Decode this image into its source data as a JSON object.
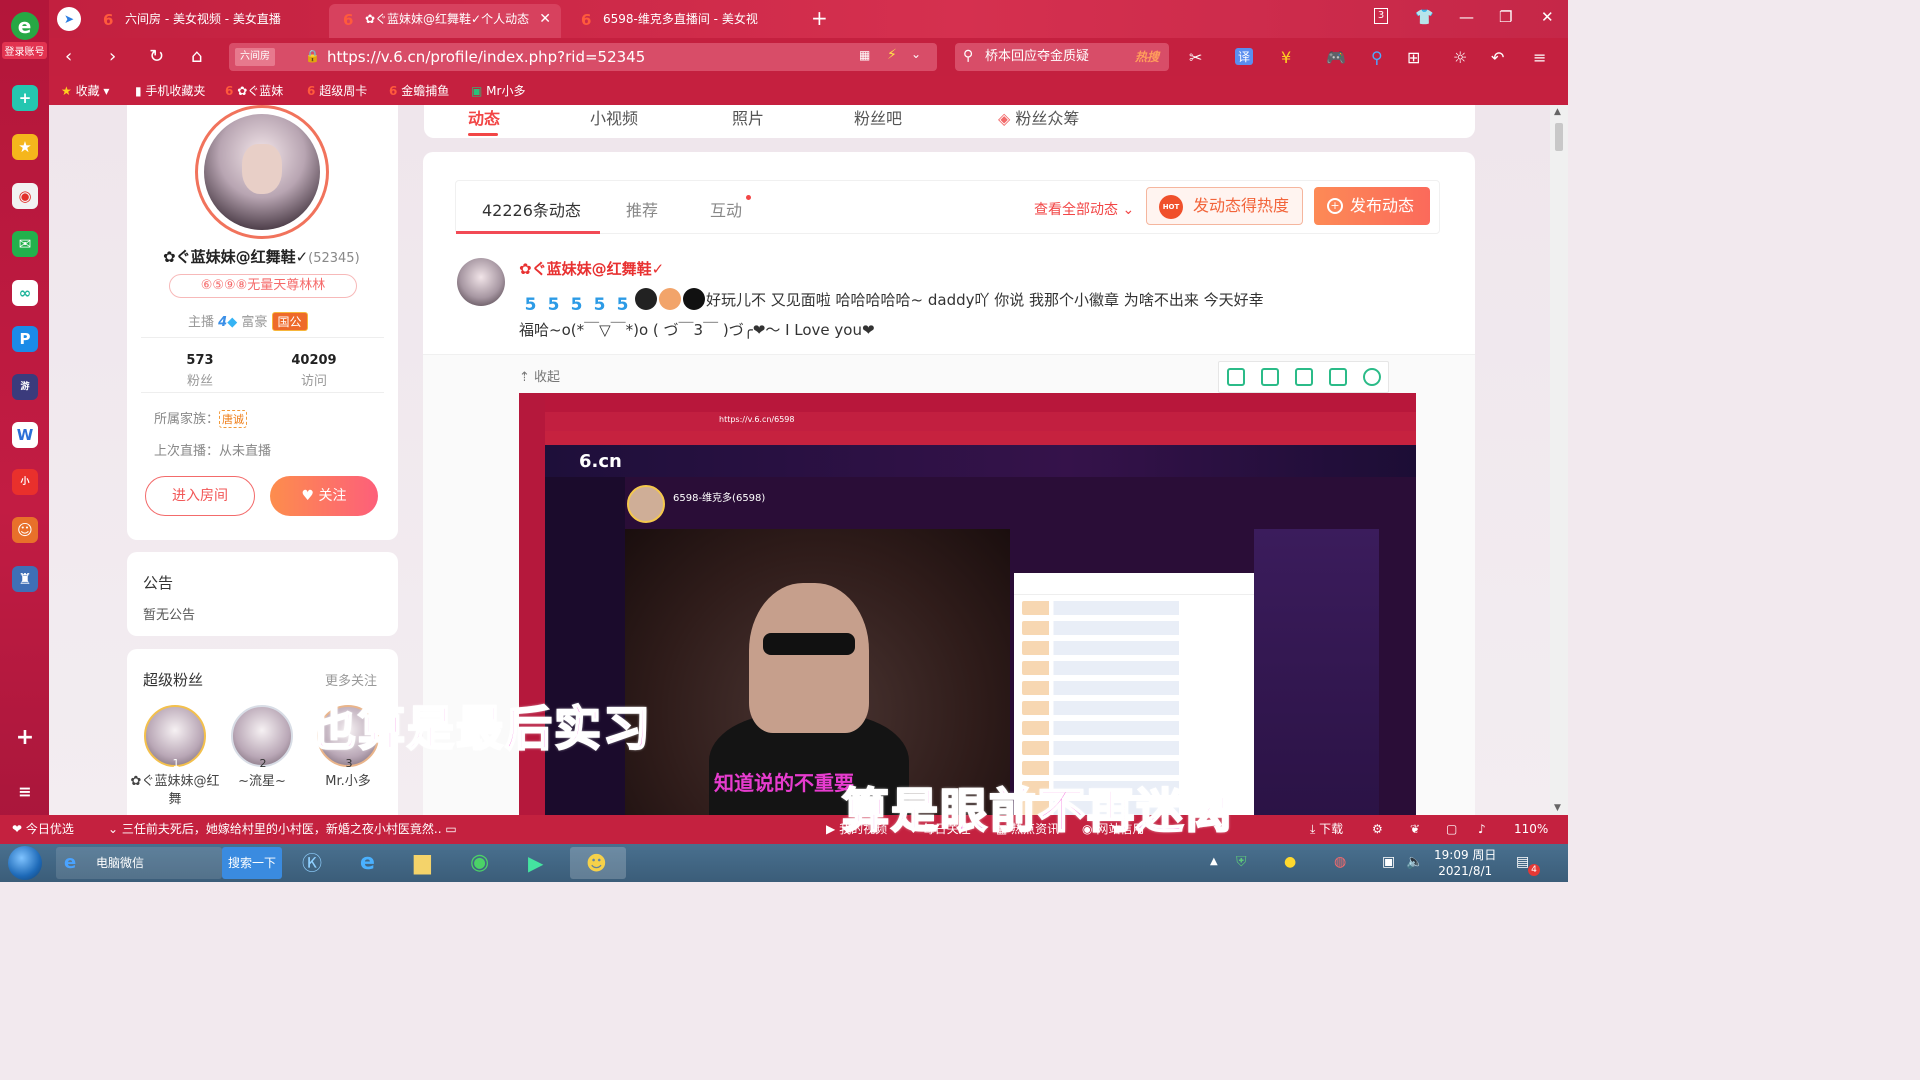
{
  "browser": {
    "login_label": "登录账号",
    "tabs": [
      {
        "title": "六间房 - 美女视频 - 美女直播"
      },
      {
        "title": "✿ぐ蓝妹妹@红舞鞋✓个人动态"
      },
      {
        "title": "6598-维克多直播间 - 美女视"
      }
    ],
    "tab_count": "3",
    "address": {
      "badge": "六间房",
      "url": "https://v.6.cn/profile/index.php?rid=52345"
    },
    "search": {
      "text": "桥本回应夺金质疑",
      "hot": "热搜"
    },
    "bookmarks": [
      "收藏",
      "手机收藏夹",
      "✿ぐ蓝妹",
      "超级周卡",
      "金蟾捕鱼",
      "Mr小多"
    ]
  },
  "profile": {
    "nickname": "✿ぐ蓝妹妹@红舞鞋✓",
    "rid": "(52345)",
    "title_pill": "⑥⑤⑨⑧无量天尊林林",
    "anchor_label": "主播",
    "anchor_level": "4",
    "rich_label": "富豪",
    "rich_badge": "国公",
    "fans_value": "573",
    "fans_label": "粉丝",
    "visits_value": "40209",
    "visits_label": "访问",
    "family_label": "所属家族：",
    "family_tag": "唐诚",
    "last_live": "上次直播：从未直播",
    "enter_room": "进入房间",
    "follow": "关注"
  },
  "notice": {
    "title": "公告",
    "content": "暂无公告"
  },
  "super_fans": {
    "title": "超级粉丝",
    "more": "更多关注",
    "items": [
      {
        "rank": "1",
        "name": "✿ぐ蓝妹妹@红舞"
      },
      {
        "rank": "2",
        "name": "~流星~"
      },
      {
        "rank": "3",
        "name": "Mr.小多"
      }
    ]
  },
  "top_tabs": [
    "动态",
    "小视频",
    "照片",
    "粉丝吧",
    "粉丝众筹"
  ],
  "feed": {
    "tabs": [
      "42226条动态",
      "推荐",
      "互动"
    ],
    "view_all": "查看全部动态",
    "heat_button": "发动态得热度",
    "hot_badge": "HOT",
    "post_button": "发布动态",
    "post": {
      "author": "✿ぐ蓝妹妹@红舞鞋✓",
      "line1": "好玩儿不 又见面啦 哈哈哈哈哈~ daddy吖 你说 我那个小徽章 为啥不出来 今天好幸",
      "line2": "福哈~o(*￣▽￣*)o ( づ￣3￣ )づ╭❤～ I Love you❤",
      "collapse": "收起"
    },
    "video": {
      "url": "https://v.6.cn/6598",
      "site_logo": "6.cn",
      "host_name": "6598-维克多(6598)",
      "sub_small": "知道说的不重要"
    }
  },
  "subtitles": {
    "line1": "也算是最后实习",
    "line2": "算是眼前不再迷离"
  },
  "statusbar": {
    "today": "今日优选",
    "news": "三任前夫死后，她嫁给村里的小村医，新婚之夜小村医竟然..",
    "items": [
      "我的视频",
      "每日关注",
      "热点资讯",
      "网站信用"
    ],
    "download": "下载",
    "zoom": "110%"
  },
  "taskbar": {
    "wechat": "电脑微信",
    "search": "搜索一下",
    "time": "19:09 周日",
    "date": "2021/8/1",
    "notif": "4"
  }
}
